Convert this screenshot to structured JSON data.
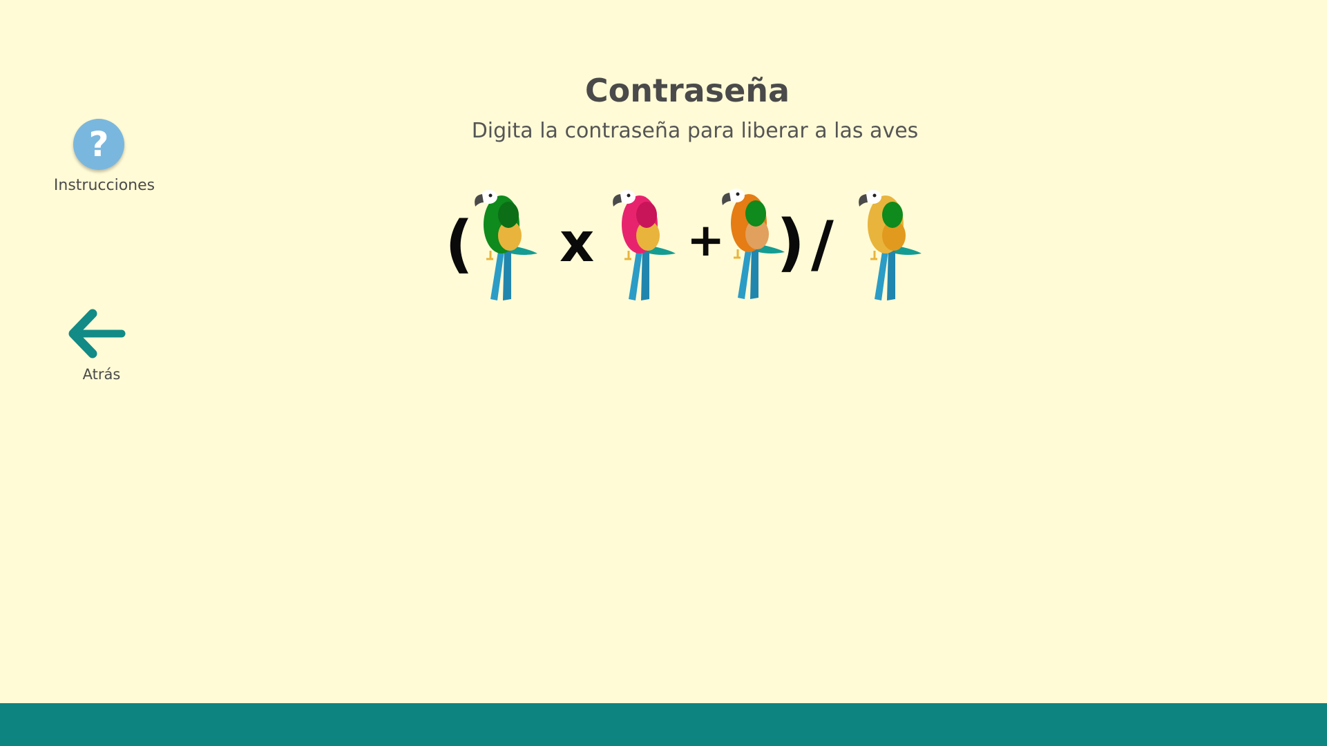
{
  "header": {
    "title": "Contraseña",
    "subtitle": "Digita la contraseña para liberar a las aves"
  },
  "sidebar": {
    "help_label": "Instrucciones",
    "help_glyph": "?",
    "back_label": "Atrás"
  },
  "equation": {
    "open_paren": "(",
    "multiply": "x",
    "plus": "+",
    "close_paren": ")",
    "divide": "/",
    "birds": [
      {
        "name": "green-parrot",
        "body": "#0f8a1c",
        "wing": "#0c6e16",
        "belly": "#e8b43c"
      },
      {
        "name": "pink-parrot",
        "body": "#e8236e",
        "wing": "#c81459",
        "belly": "#e8b43c"
      },
      {
        "name": "orange-parrot",
        "body": "#e57c14",
        "wing": "#0f8a1c",
        "belly": "#e1a05e"
      },
      {
        "name": "yellow-parrot",
        "body": "#e8b43c",
        "wing": "#0f8a1c",
        "belly": "#e19a1e"
      }
    ]
  },
  "colors": {
    "background": "#fffbd6",
    "footer": "#0e8480",
    "help_button": "#7ab7de",
    "back_arrow": "#128a86",
    "tail": "#2b9cc6"
  }
}
